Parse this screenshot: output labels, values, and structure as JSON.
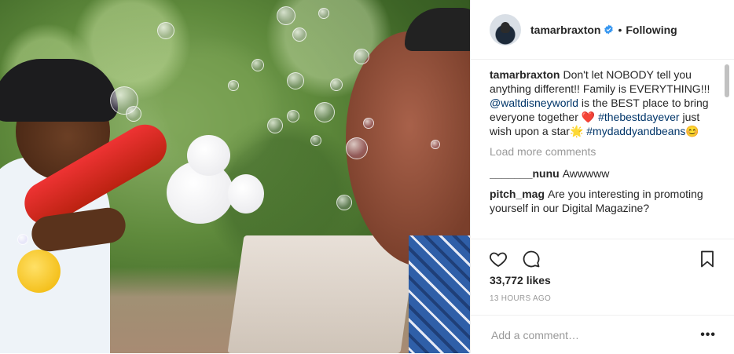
{
  "header": {
    "username": "tamarbraxton",
    "separator": "•",
    "follow_status": "Following"
  },
  "comments": [
    {
      "user": "tamarbraxton",
      "parts": [
        {
          "text": "Don't let NOBODY tell you anything different!! Family is EVERYTHING!!! ",
          "link": false
        },
        {
          "text": "@waltdisneyworld",
          "link": true
        },
        {
          "text": " is the BEST place to bring everyone together ❤️ ",
          "link": false
        },
        {
          "text": "#thebestdayever",
          "link": true
        },
        {
          "text": " just wish upon a star🌟 ",
          "link": false
        },
        {
          "text": "#mydaddyandbeans",
          "link": true
        },
        {
          "text": "😊",
          "link": false
        }
      ]
    }
  ],
  "load_more": "Load more comments",
  "replies": [
    {
      "user": "_______nunu",
      "text": "Awwwww"
    },
    {
      "user": "pitch_mag",
      "text": "Are you interesting in promoting yourself in our Digital Magazine?"
    }
  ],
  "likes": "33,772 likes",
  "timestamp": "13 HOURS AGO",
  "add_comment": {
    "placeholder": "Add a comment…"
  },
  "more_label": "•••"
}
